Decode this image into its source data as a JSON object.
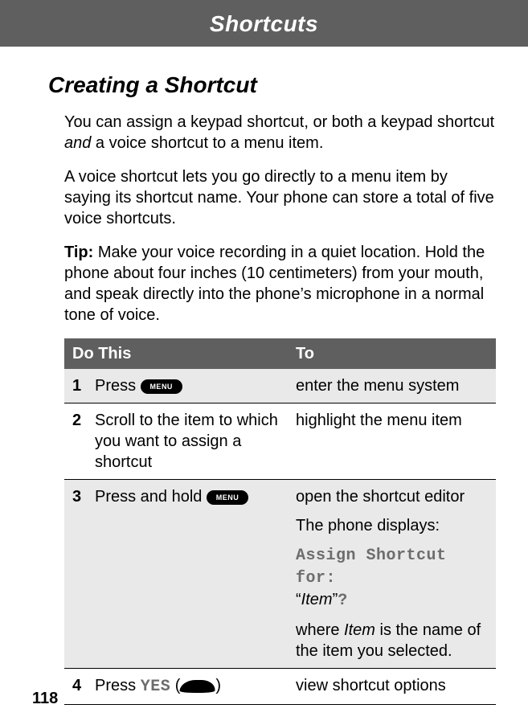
{
  "header": {
    "title": "Shortcuts"
  },
  "section": {
    "title": "Creating a Shortcut"
  },
  "paragraphs": {
    "p1_a": "You can assign a keypad shortcut, or both a keypad shortcut ",
    "p1_b": "and",
    "p1_c": " a voice shortcut to a menu item.",
    "p2": "A voice shortcut lets you go directly to a menu item by saying its shortcut name. Your phone can store a total of five voice shortcuts.",
    "tip_label": "Tip:",
    "tip_body": " Make your voice recording in a quiet location. Hold the phone about four inches (10 centimeters) from your mouth, and speak directly into the phone’s microphone in a normal tone of voice."
  },
  "table": {
    "head_action": "Do This",
    "head_result": "To",
    "rows": {
      "r1": {
        "num": "1",
        "action_prefix": "Press ",
        "menu_label": "MENU",
        "result": "enter the menu system"
      },
      "r2": {
        "num": "2",
        "action": "Scroll to the item to which you want to assign a shortcut",
        "result": "highlight the menu item"
      },
      "r3": {
        "num": "3",
        "action_prefix": "Press and hold ",
        "menu_label": "MENU",
        "result_line1": "open the shortcut editor",
        "result_line2": "The phone displays:",
        "assign_label": "Assign Shortcut for:",
        "quote_open": "“",
        "item_word": "Item",
        "quote_close": "”",
        "qmark": "?",
        "where_a": "where ",
        "where_b": "Item",
        "where_c": " is the name of the item you selected."
      },
      "r4": {
        "num": "4",
        "action_prefix": "Press ",
        "yes_label": "YES",
        "paren_open": " (",
        "paren_close": ")",
        "result": "view shortcut options"
      }
    }
  },
  "page_number": "118"
}
